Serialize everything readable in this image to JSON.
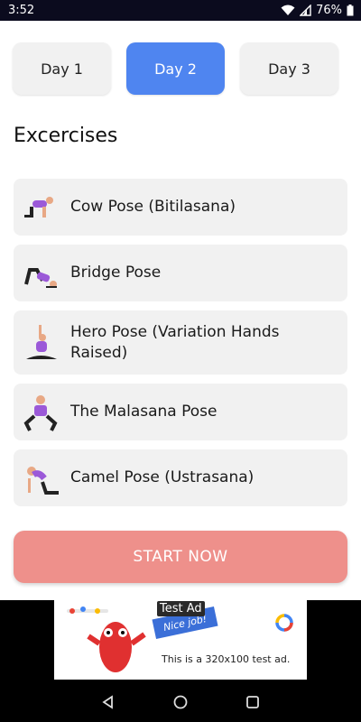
{
  "status_bar": {
    "time": "3:52",
    "battery": "76%"
  },
  "days": [
    {
      "label": "Day 1",
      "active": false
    },
    {
      "label": "Day 2",
      "active": true
    },
    {
      "label": "Day 3",
      "active": false
    }
  ],
  "section_title": "Excercises",
  "exercises": [
    {
      "label": "Cow Pose (Bitilasana)",
      "icon": "cow-pose-icon"
    },
    {
      "label": "Bridge Pose",
      "icon": "bridge-pose-icon"
    },
    {
      "label": "Hero Pose (Variation Hands Raised)",
      "icon": "hero-pose-icon"
    },
    {
      "label": "The Malasana Pose",
      "icon": "malasana-pose-icon"
    },
    {
      "label": "Camel Pose (Ustrasana)",
      "icon": "camel-pose-icon"
    }
  ],
  "start_button": "START NOW",
  "ad": {
    "tag": "Test Ad",
    "text": "This is a 320x100 test ad.",
    "nice": "Nice job!"
  },
  "colors": {
    "accent": "#4f85f0",
    "start_button": "#ee908b",
    "tile": "#f1f1f1",
    "figure_top": "#9b59d8"
  }
}
